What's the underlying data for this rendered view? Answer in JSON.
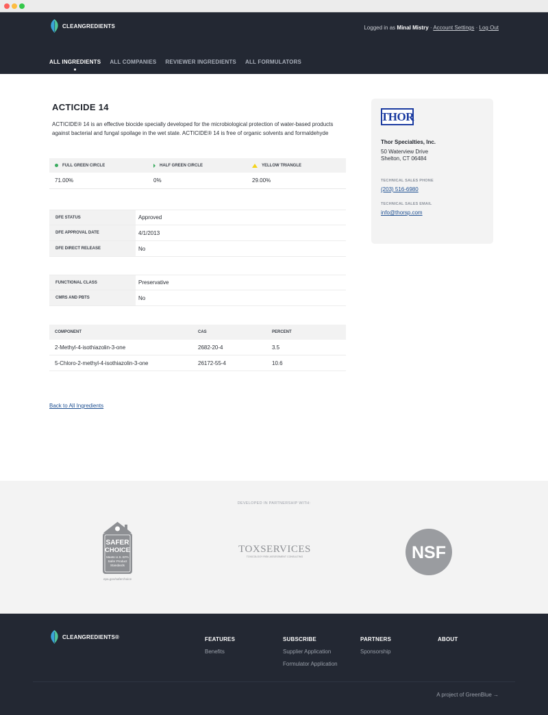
{
  "brand": {
    "name": "CLEANGREDIENTS",
    "footer_name": "CLEANGREDIENTS®"
  },
  "userbar": {
    "prefix": "Logged in as",
    "user": "Minal Mistry",
    "sep1": "·",
    "account": "Account Settings",
    "sep2": "·",
    "logout": "Log Out"
  },
  "nav": {
    "items": [
      {
        "label": "ALL INGREDIENTS",
        "active": true
      },
      {
        "label": "ALL COMPANIES",
        "active": false
      },
      {
        "label": "REVIEWER INGREDIENTS",
        "active": false
      },
      {
        "label": "ALL FORMULATORS",
        "active": false
      }
    ]
  },
  "ingredient": {
    "title": "ACTICIDE 14",
    "description": "ACTICIDE® 14 is an effective biocide specially developed for the microbiological protection of water-based products against bacterial and fungal spoilage in the wet state. ACTICIDE® 14 is free of organic solvents and formaldehyde"
  },
  "circles": {
    "headers": [
      "FULL GREEN CIRCLE",
      "HALF GREEN CIRCLE",
      "YELLOW TRIANGLE"
    ],
    "values": [
      "71.00%",
      "0%",
      "29.00%"
    ],
    "colors": {
      "green": "#3aab5f",
      "yellow": "#f3d31a"
    }
  },
  "dfe": {
    "rows": [
      {
        "key": "DFE STATUS",
        "value": "Approved"
      },
      {
        "key": "DFE APPROVAL DATE",
        "value": "4/1/2013"
      },
      {
        "key": "DFE DIRECT RELEASE",
        "value": "No"
      }
    ]
  },
  "functional": {
    "rows": [
      {
        "key": "FUNCTIONAL CLASS",
        "value": "Preservative"
      },
      {
        "key": "CMRS AND PBTS",
        "value": "No"
      }
    ]
  },
  "components": {
    "headers": [
      "COMPONENT",
      "CAS",
      "PERCENT"
    ],
    "rows": [
      [
        "2-Methyl-4-isothiazolin-3-one",
        "2682-20-4",
        "3.5"
      ],
      [
        "5-Chloro-2-methyl-4-isothiazolin-3-one",
        "26172-55-4",
        "10.6"
      ]
    ]
  },
  "back_link": "Back to All Ingredients",
  "company": {
    "logo_text": "THOR",
    "name": "Thor Specialties, Inc.",
    "address1": "50 Waterview Drive",
    "address2": "Shelton, CT 06484",
    "phone_label": "TECHNICAL SALES PHONE",
    "phone": "(203) 516-6980",
    "email_label": "TECHNICAL SALES EMAIL",
    "email": "info@thorsp.com"
  },
  "partners": {
    "caption": "DEVELOPED IN PARTNERSHIP WITH:",
    "safer_choice": {
      "line1": "SAFER",
      "line2": "CHOICE",
      "line3": "Meets U.S. EPA",
      "line4": "Safer Product",
      "line5": "Standards",
      "url": "epa.gov/saferchoice"
    },
    "toxservices": {
      "main": "TOXSERVICES",
      "sub": "TOXICOLOGY RISK ASSESSMENT CONSULTING"
    },
    "nsf": {
      "text": "NSF"
    }
  },
  "footer": {
    "columns": [
      {
        "heading": "FEATURES",
        "links": [
          "Benefits"
        ]
      },
      {
        "heading": "SUBSCRIBE",
        "links": [
          "Supplier Application",
          "Formulator Application"
        ]
      },
      {
        "heading": "PARTNERS",
        "links": [
          "Sponsorship"
        ]
      },
      {
        "heading": "ABOUT",
        "links": []
      }
    ],
    "project": "A project of GreenBlue →"
  }
}
